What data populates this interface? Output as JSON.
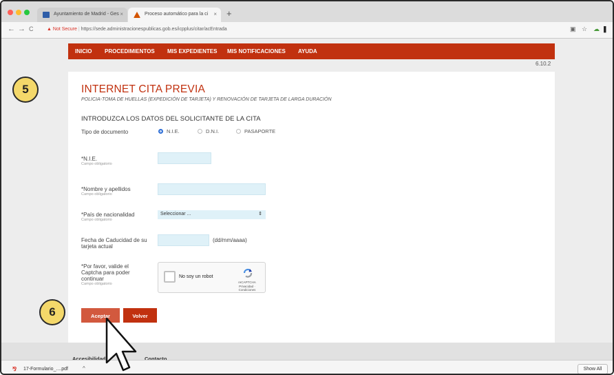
{
  "browser": {
    "tabs": [
      {
        "label": "Ayuntamiento de Madrid - Ges",
        "close": "×",
        "active": false
      },
      {
        "label": "Proceso automático para la ci",
        "close": "×",
        "active": true
      }
    ],
    "new_tab": "+",
    "back": "←",
    "forward": "→",
    "reload": "C",
    "security_icon": "warning-triangle",
    "security_warning": "▲",
    "security_text": "Not Secure",
    "url": "https://sede.administracionespublicas.gob.es/icpplus/citar/acEntrada",
    "toolbar_icons": [
      "extension-icon",
      "star-icon",
      "cloud-icon",
      "profile-icon",
      "menu-icon"
    ]
  },
  "nav": {
    "items": [
      "INICIO",
      "PROCEDIMIENTOS",
      "MIS EXPEDIENTES",
      "MIS NOTIFICACIONES",
      "AYUDA"
    ]
  },
  "version": "6.10.2",
  "form": {
    "title": "INTERNET CITA PREVIA",
    "subtitle": "POLICIA-TOMA DE HUELLAS (EXPEDICIÓN DE TARJETA) Y RENOVACIÓN DE TARJETA DE LARGA DURACIÓN",
    "section": "INTRODUZCA LOS DATOS DEL SOLICITANTE DE LA CITA",
    "doc_type_label": "Tipo de documento",
    "doc_options": [
      {
        "label": "N.I.E.",
        "selected": true
      },
      {
        "label": "D.N.I.",
        "selected": false
      },
      {
        "label": "PASAPORTE",
        "selected": false
      }
    ],
    "nie_label": "*N.I.E.",
    "required_note": "Campo obligatorio",
    "name_label": "*Nombre y apellidos",
    "nationality_label": "*País de nacionalidad",
    "nationality_value": "Seleccionar ...",
    "expiry_label_1": "Fecha de Caducidad de su",
    "expiry_label_2": "tarjeta actual",
    "date_hint": "(dd/mm/aaaa)",
    "captcha_label_1": "*Por favor, valide el",
    "captcha_label_2": "Captcha para poder",
    "captcha_label_3": "continuar",
    "captcha": {
      "checkbox_text": "No soy un robot",
      "brand": "reCAPTCHA",
      "links": "Privacidad · Condiciones"
    },
    "accept": "Aceptar",
    "back": "Volver"
  },
  "footer": {
    "links": [
      "Accesibilidad",
      "Contacto"
    ]
  },
  "downloads": {
    "file": "17-Formulario_....pdf",
    "caret": "^",
    "show_all": "Show All"
  },
  "badges": [
    "5",
    "6"
  ],
  "colors": {
    "brand_red": "#c1310f",
    "input_bg": "#dff1f8",
    "badge_yellow": "#f4d86a"
  }
}
